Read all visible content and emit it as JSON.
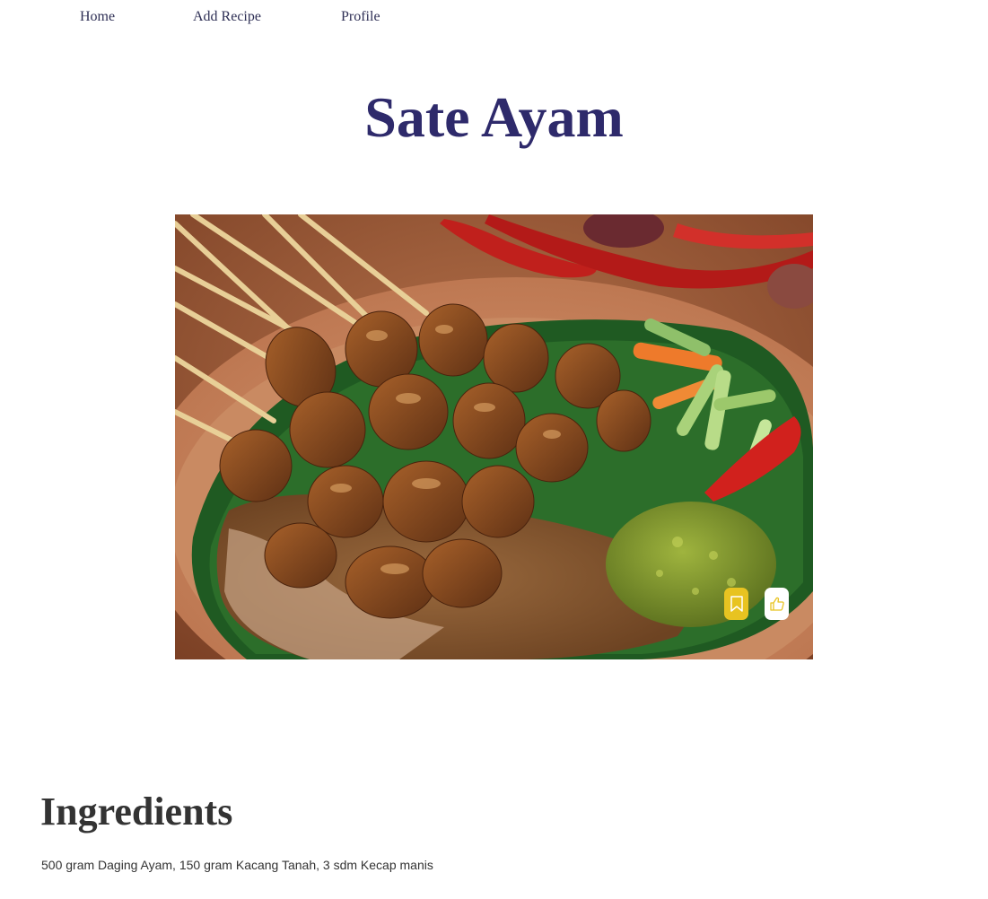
{
  "nav": {
    "items": [
      {
        "label": "Home"
      },
      {
        "label": "Add Recipe"
      },
      {
        "label": "Profile"
      }
    ]
  },
  "recipe": {
    "title": "Sate Ayam",
    "image": {
      "actions": {
        "save_icon": "bookmark-icon",
        "like_icon": "thumbs-up-icon"
      }
    }
  },
  "ingredients": {
    "heading": "Ingredients",
    "text": "500 gram Daging Ayam, 150 gram Kacang Tanah, 3 sdm Kecap manis"
  },
  "colors": {
    "title": "#2e2a6b",
    "nav_text": "#2e2f55",
    "save_button": "#e8c321",
    "like_button": "#ffffff",
    "icon_stroke": "#e8c321"
  }
}
